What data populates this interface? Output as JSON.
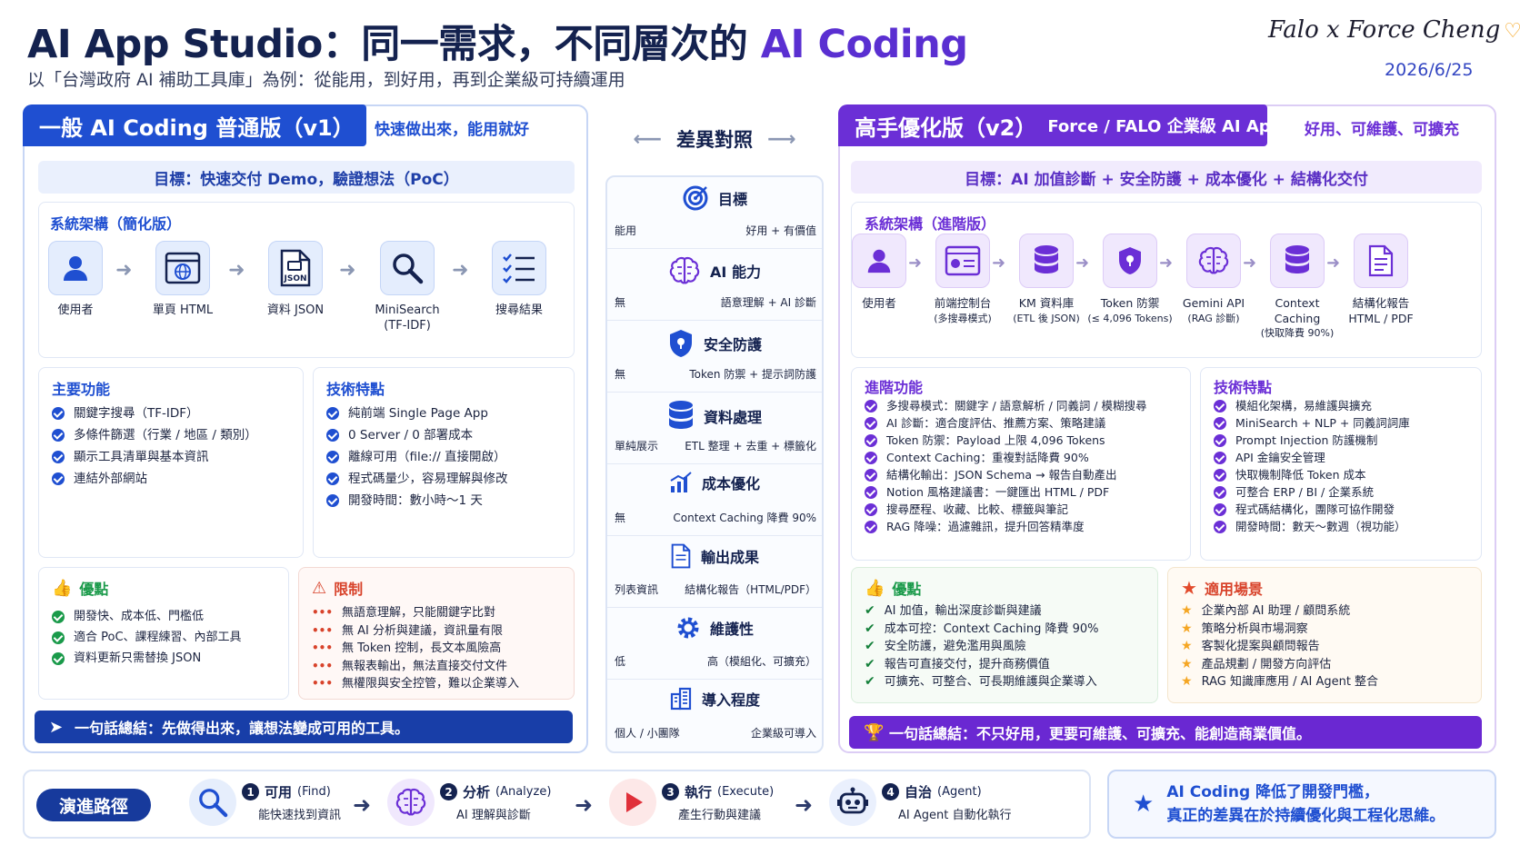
{
  "header": {
    "title_main": "AI App Studio：同一需求，不同層次的 ",
    "title_highlight": "AI Coding",
    "subtitle": "以「台灣政府 AI 補助工具庫」為例：從能用，到好用，再到企業級可持續運用",
    "authors": "Falo x Force Cheng",
    "date": "2026/6/25"
  },
  "left": {
    "tab": "一般 AI Coding 普通版（v1）",
    "tagline": "快速做出來，能用就好",
    "goal": "目標：快速交付 Demo，驗證想法（PoC）",
    "arch_title": "系統架構（簡化版）",
    "arch_nodes": [
      {
        "label": "使用者",
        "icon": "user-icon"
      },
      {
        "label": "單頁 HTML",
        "icon": "browser-icon"
      },
      {
        "label": "資料 JSON",
        "icon": "json-file-icon",
        "icon_text": "JSON"
      },
      {
        "label": "MiniSearch",
        "sub": "(TF-IDF)",
        "icon": "search-icon"
      },
      {
        "label": "搜尋結果",
        "icon": "checklist-icon"
      }
    ],
    "features_title": "主要功能",
    "features": [
      "關鍵字搜尋（TF-IDF）",
      "多條件篩選（行業 / 地區 / 類別）",
      "顯示工具清單與基本資訊",
      "連結外部網站"
    ],
    "tech_title": "技術特點",
    "tech": [
      "純前端 Single Page App",
      "0 Server / 0 部署成本",
      "離線可用（file:// 直接開啟）",
      "程式碼量少，容易理解與修改",
      "開發時間：數小時～1 天"
    ],
    "pros_title": "優點",
    "pros": [
      "開發快、成本低、門檻低",
      "適合 PoC、課程練習、內部工具",
      "資料更新只需替換 JSON"
    ],
    "cons_title": "限制",
    "cons": [
      "無語意理解，只能關鍵字比對",
      "無 AI 分析與建議，資訊量有限",
      "無 Token 控制，長文本風險高",
      "無報表輸出，無法直接交付文件",
      "無權限與安全控管，難以企業導入"
    ],
    "summary": "一句話總結：先做得出來，讓想法變成可用的工具。"
  },
  "middle": {
    "title": "差異對照",
    "rows": [
      {
        "title": "目標",
        "icon": "target-icon",
        "left": "能用",
        "right": "好用 + 有價值"
      },
      {
        "title": "AI 能力",
        "icon": "brain-icon",
        "left": "無",
        "right": "語意理解 + AI 診斷"
      },
      {
        "title": "安全防護",
        "icon": "shield-icon",
        "left": "無",
        "right": "Token 防禦 + 提示詞防護"
      },
      {
        "title": "資料處理",
        "icon": "database-icon",
        "left": "單純展示",
        "right": "ETL 整理 + 去重 + 標籤化"
      },
      {
        "title": "成本優化",
        "icon": "chart-icon",
        "left": "無",
        "right": "Context Caching 降費 90%"
      },
      {
        "title": "輸出成果",
        "icon": "document-icon",
        "left": "列表資訊",
        "right": "結構化報告（HTML/PDF）"
      },
      {
        "title": "維護性",
        "icon": "gear-icon",
        "left": "低",
        "right": "高（模組化、可擴充）"
      },
      {
        "title": "導入程度",
        "icon": "building-icon",
        "left": "個人 / 小團隊",
        "right": "企業級可導入"
      }
    ]
  },
  "right": {
    "tab": "高手優化版（v2）",
    "tab_sub": "Force / FALO 企業級 AI App",
    "tagline": "好用、可維護、可擴充",
    "goal": "目標：AI 加值診斷 + 安全防護 + 成本優化 + 結構化交付",
    "arch_title": "系統架構（進階版）",
    "arch_nodes": [
      {
        "label": "使用者",
        "icon": "user-icon"
      },
      {
        "label": "前端控制台",
        "sub": "(多搜尋模式)",
        "icon": "dashboard-icon"
      },
      {
        "label": "KM 資料庫",
        "sub": "(ETL 後 JSON)",
        "icon": "database-icon"
      },
      {
        "label": "Token 防禦",
        "sub": "(≤ 4,096 Tokens)",
        "icon": "shield-icon"
      },
      {
        "label": "Gemini API",
        "sub": "(RAG 診斷)",
        "icon": "brain-icon"
      },
      {
        "label": "Context",
        "sub": "Caching",
        "sub2": "(快取降費 90%)",
        "icon": "cache-icon"
      },
      {
        "label": "結構化報告",
        "sub": "HTML / PDF",
        "icon": "report-icon"
      }
    ],
    "features_title": "進階功能",
    "features": [
      "多搜尋模式：關鍵字 / 語意解析 / 同義詞 / 模糊搜尋",
      "AI 診斷：適合度評估、推薦方案、策略建議",
      "Token 防禦：Payload 上限 4,096 Tokens",
      "Context Caching：重複對話降費 90%",
      "結構化輸出：JSON Schema → 報告自動產出",
      "Notion 風格建議書：一鍵匯出 HTML / PDF",
      "搜尋歷程、收藏、比較、標籤與筆記",
      "RAG 降噪：過濾雜訊，提升回答精準度"
    ],
    "tech_title": "技術特點",
    "tech": [
      "模組化架構，易維護與擴充",
      "MiniSearch + NLP + 同義詞詞庫",
      "Prompt Injection 防護機制",
      "API 金鑰安全管理",
      "快取機制降低 Token 成本",
      "可整合 ERP / BI / 企業系統",
      "程式碼結構化，團隊可協作開發",
      "開發時間：數天～數週（視功能）"
    ],
    "pros_title": "優點",
    "pros": [
      "AI 加值，輸出深度診斷與建議",
      "成本可控：Context Caching 降費 90%",
      "安全防護，避免濫用與風險",
      "報告可直接交付，提升商務價值",
      "可擴充、可整合、可長期維護與企業導入"
    ],
    "scen_title": "適用場景",
    "scen": [
      "企業內部 AI 助理 / 顧問系統",
      "策略分析與市場洞察",
      "客製化提案與顧問報告",
      "產品規劃 / 開發方向評估",
      "RAG 知識庫應用 / AI Agent 整合"
    ],
    "summary": "一句話總結：不只好用，更要可維護、可擴充、能創造商業價值。"
  },
  "path": {
    "badge": "演進路徑",
    "steps": [
      {
        "num": "1",
        "title": "可用",
        "en": "(Find)",
        "desc": "能快速找到資訊",
        "icon": "search-icon"
      },
      {
        "num": "2",
        "title": "分析",
        "en": "(Analyze)",
        "desc": "AI 理解與診斷",
        "icon": "brain-icon"
      },
      {
        "num": "3",
        "title": "執行",
        "en": "(Execute)",
        "desc": "產生行動與建議",
        "icon": "play-icon"
      },
      {
        "num": "4",
        "title": "自治",
        "en": "(Agent)",
        "desc": "AI Agent 自動化執行",
        "icon": "robot-icon"
      }
    ]
  },
  "conclusion": {
    "line1": "AI Coding 降低了開發門檻，",
    "line2": "真正的差異在於持續優化與工程化思維。"
  },
  "colors": {
    "blue": "#1f4fd1",
    "purple": "#6b2fd6",
    "navy": "#14224f",
    "green": "#1a9a4a",
    "red": "#d8432b",
    "gold": "#f5a623"
  }
}
